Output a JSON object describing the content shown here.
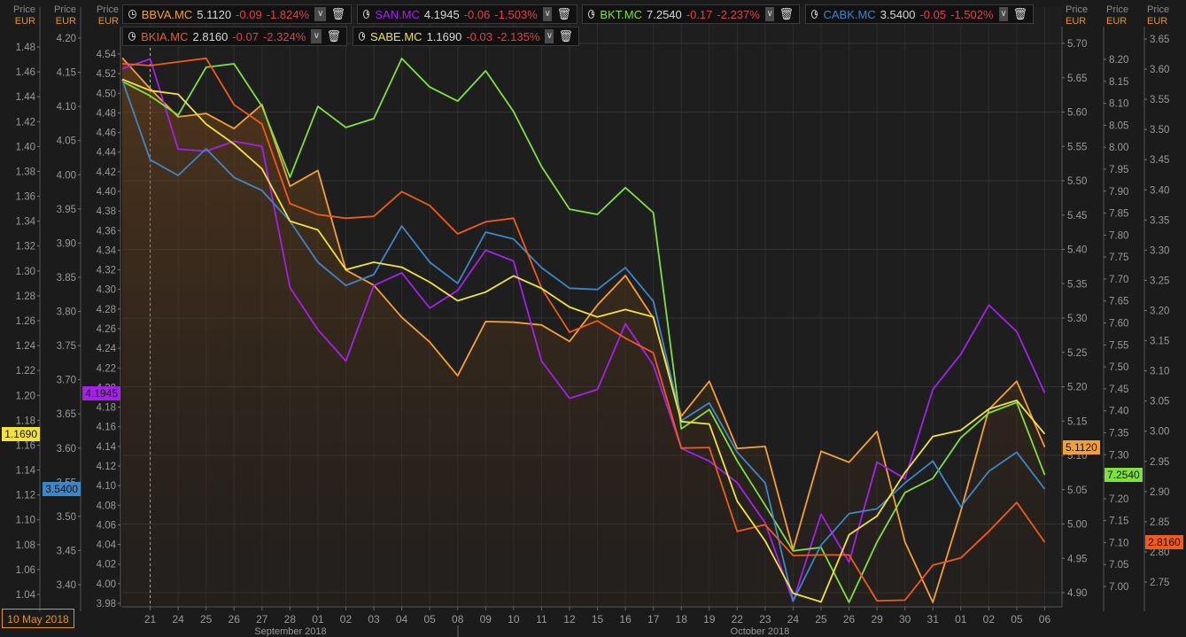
{
  "axis_headers": {
    "price": "Price",
    "currency": "EUR"
  },
  "date_box": "10 May 2018",
  "legend": [
    {
      "symbol": "BBVA.MC",
      "value": "5.1120",
      "change": "-0.09",
      "pct": "-1.824%",
      "color": "#f5a034"
    },
    {
      "symbol": "SAN.MC",
      "value": "4.1945",
      "change": "-0.06",
      "pct": "-1.503%",
      "color": "#a621e8"
    },
    {
      "symbol": "BKT.MC",
      "value": "7.2540",
      "change": "-0.17",
      "pct": "-2.237%",
      "color": "#80e040"
    },
    {
      "symbol": "CABK.MC",
      "value": "3.5400",
      "change": "-0.05",
      "pct": "-1.502%",
      "color": "#3d86c8"
    },
    {
      "symbol": "BKIA.MC",
      "value": "2.8160",
      "change": "-0.07",
      "pct": "-2.324%",
      "color": "#f05a1a"
    },
    {
      "symbol": "SABE.MC",
      "value": "1.1690",
      "change": "-0.03",
      "pct": "-2.135%",
      "color": "#f2e23e"
    }
  ],
  "icons": {
    "clock": "clock-icon",
    "dropdown": "chevron-down-icon",
    "delete": "trash-icon"
  },
  "chart_data": {
    "type": "line",
    "x": [
      "20",
      "21",
      "24",
      "25",
      "26",
      "27",
      "28",
      "01",
      "02",
      "03",
      "04",
      "05",
      "08",
      "09",
      "10",
      "11",
      "12",
      "15",
      "16",
      "17",
      "18",
      "19",
      "22",
      "23",
      "24",
      "25",
      "26",
      "29",
      "30",
      "31",
      "01",
      "02",
      "05",
      "06"
    ],
    "x_tick_labels": [
      "21",
      "24",
      "25",
      "26",
      "27",
      "28",
      "01",
      "02",
      "03",
      "04",
      "05",
      "08",
      "09",
      "10",
      "11",
      "12",
      "15",
      "16",
      "17",
      "18",
      "19",
      "22",
      "23",
      "24",
      "25",
      "26",
      "29",
      "30",
      "31",
      "01",
      "02",
      "05",
      "06"
    ],
    "month_labels": [
      "September 2018",
      "October 2018"
    ],
    "grid": true,
    "crosshair_x": "21",
    "axes": {
      "left1": {
        "series": "SABE.MC",
        "range": [
          1.04,
          1.48
        ],
        "ticks": [
          "1.04",
          "1.06",
          "1.08",
          "1.10",
          "1.12",
          "1.14",
          "1.16",
          "1.18",
          "1.20",
          "1.22",
          "1.24",
          "1.26",
          "1.28",
          "1.30",
          "1.32",
          "1.34",
          "1.36",
          "1.38",
          "1.40",
          "1.42",
          "1.44",
          "1.46",
          "1.48"
        ]
      },
      "left2": {
        "series": "CABK.MC",
        "range": [
          3.4,
          4.2
        ],
        "ticks": [
          "3.40",
          "3.45",
          "3.50",
          "3.55",
          "3.60",
          "3.65",
          "3.70",
          "3.75",
          "3.80",
          "3.85",
          "3.90",
          "3.95",
          "4.00",
          "4.05",
          "4.10",
          "4.15",
          "4.20"
        ]
      },
      "left3": {
        "series": "SAN.MC",
        "range": [
          3.98,
          4.54
        ],
        "ticks": [
          "3.98",
          "4.00",
          "4.02",
          "4.04",
          "4.06",
          "4.08",
          "4.10",
          "4.12",
          "4.14",
          "4.16",
          "4.18",
          "4.20",
          "4.22",
          "4.24",
          "4.26",
          "4.28",
          "4.30",
          "4.32",
          "4.34",
          "4.36",
          "4.38",
          "4.40",
          "4.42",
          "4.44",
          "4.46",
          "4.48",
          "4.50",
          "4.52",
          "4.54"
        ]
      },
      "right1": {
        "series": "BBVA.MC",
        "range": [
          4.9,
          5.7
        ],
        "ticks": [
          "4.90",
          "4.95",
          "5.00",
          "5.05",
          "5.10",
          "5.15",
          "5.20",
          "5.25",
          "5.30",
          "5.35",
          "5.40",
          "5.45",
          "5.50",
          "5.55",
          "5.60",
          "5.65",
          "5.70"
        ]
      },
      "right2": {
        "series": "BKT.MC",
        "range": [
          7.0,
          8.2
        ],
        "ticks": [
          "7.00",
          "7.05",
          "7.10",
          "7.15",
          "7.20",
          "7.25",
          "7.30",
          "7.35",
          "7.40",
          "7.45",
          "7.50",
          "7.55",
          "7.60",
          "7.65",
          "7.70",
          "7.75",
          "7.80",
          "7.85",
          "7.90",
          "7.95",
          "8.00",
          "8.05",
          "8.10",
          "8.15",
          "8.20"
        ]
      },
      "right3": {
        "series": "BKIA.MC",
        "range": [
          2.75,
          3.65
        ],
        "ticks": [
          "2.75",
          "2.80",
          "2.85",
          "2.90",
          "2.95",
          "3.00",
          "3.05",
          "3.10",
          "3.15",
          "3.20",
          "3.25",
          "3.30",
          "3.35",
          "3.40",
          "3.45",
          "3.50",
          "3.55",
          "3.60",
          "3.65"
        ]
      }
    },
    "series": [
      {
        "name": "BBVA.MC",
        "axis": "right1",
        "color": "#f5a034",
        "area": true,
        "last": "5.1120",
        "values": [
          5.679,
          5.634,
          5.593,
          5.598,
          5.576,
          5.611,
          5.492,
          5.515,
          5.37,
          5.348,
          5.301,
          5.265,
          5.216,
          5.295,
          5.294,
          5.29,
          5.266,
          5.319,
          5.362,
          5.3,
          5.157,
          5.208,
          5.11,
          5.113,
          4.963,
          5.106,
          5.09,
          5.135,
          4.974,
          4.886,
          5.019,
          5.167,
          5.208,
          5.112
        ]
      },
      {
        "name": "SAN.MC",
        "axis": "left3",
        "color": "#a621e8",
        "last": "4.1945",
        "values": [
          4.525,
          4.535,
          4.443,
          4.441,
          4.451,
          4.446,
          4.302,
          4.259,
          4.227,
          4.304,
          4.317,
          4.281,
          4.299,
          4.34,
          4.329,
          4.227,
          4.189,
          4.198,
          4.265,
          4.223,
          4.138,
          4.125,
          4.103,
          4.062,
          3.982,
          4.071,
          4.022,
          4.124,
          4.107,
          4.198,
          4.234,
          4.284,
          4.257,
          4.1945
        ]
      },
      {
        "name": "BKT.MC",
        "axis": "right2",
        "color": "#80e040",
        "last": "7.2540",
        "values": [
          8.15,
          8.117,
          8.073,
          8.182,
          8.19,
          8.093,
          7.932,
          8.093,
          8.045,
          8.065,
          8.202,
          8.137,
          8.105,
          8.174,
          8.081,
          7.956,
          7.859,
          7.847,
          7.908,
          7.851,
          7.359,
          7.403,
          7.286,
          7.185,
          7.081,
          7.089,
          6.964,
          7.101,
          7.214,
          7.246,
          7.339,
          7.395,
          7.419,
          7.254
        ]
      },
      {
        "name": "CABK.MC",
        "axis": "left2",
        "color": "#3d86c8",
        "last": "3.5400",
        "values": [
          4.139,
          4.022,
          3.999,
          4.038,
          3.996,
          3.977,
          3.932,
          3.872,
          3.838,
          3.854,
          3.925,
          3.872,
          3.841,
          3.916,
          3.906,
          3.864,
          3.834,
          3.832,
          3.864,
          3.815,
          3.64,
          3.666,
          3.594,
          3.549,
          3.376,
          3.458,
          3.504,
          3.511,
          3.549,
          3.581,
          3.514,
          3.566,
          3.594,
          3.54
        ]
      },
      {
        "name": "BKIA.MC",
        "axis": "right3",
        "color": "#f05a1a",
        "last": "2.8160",
        "values": [
          3.609,
          3.606,
          3.612,
          3.618,
          3.541,
          3.509,
          3.377,
          3.359,
          3.353,
          3.356,
          3.397,
          3.374,
          3.327,
          3.347,
          3.353,
          3.237,
          3.164,
          3.183,
          3.154,
          3.13,
          2.972,
          2.973,
          2.834,
          2.845,
          2.794,
          2.795,
          2.795,
          2.719,
          2.72,
          2.778,
          2.79,
          2.834,
          2.882,
          2.816
        ]
      },
      {
        "name": "SABE.MC",
        "axis": "left1",
        "color": "#f2e23e",
        "last": "1.1690",
        "values": [
          1.454,
          1.445,
          1.442,
          1.418,
          1.402,
          1.382,
          1.34,
          1.333,
          1.301,
          1.307,
          1.303,
          1.291,
          1.276,
          1.283,
          1.296,
          1.286,
          1.271,
          1.263,
          1.269,
          1.263,
          1.179,
          1.177,
          1.115,
          1.083,
          1.041,
          1.034,
          1.088,
          1.103,
          1.138,
          1.167,
          1.172,
          1.189,
          1.196,
          1.169
        ]
      }
    ]
  }
}
